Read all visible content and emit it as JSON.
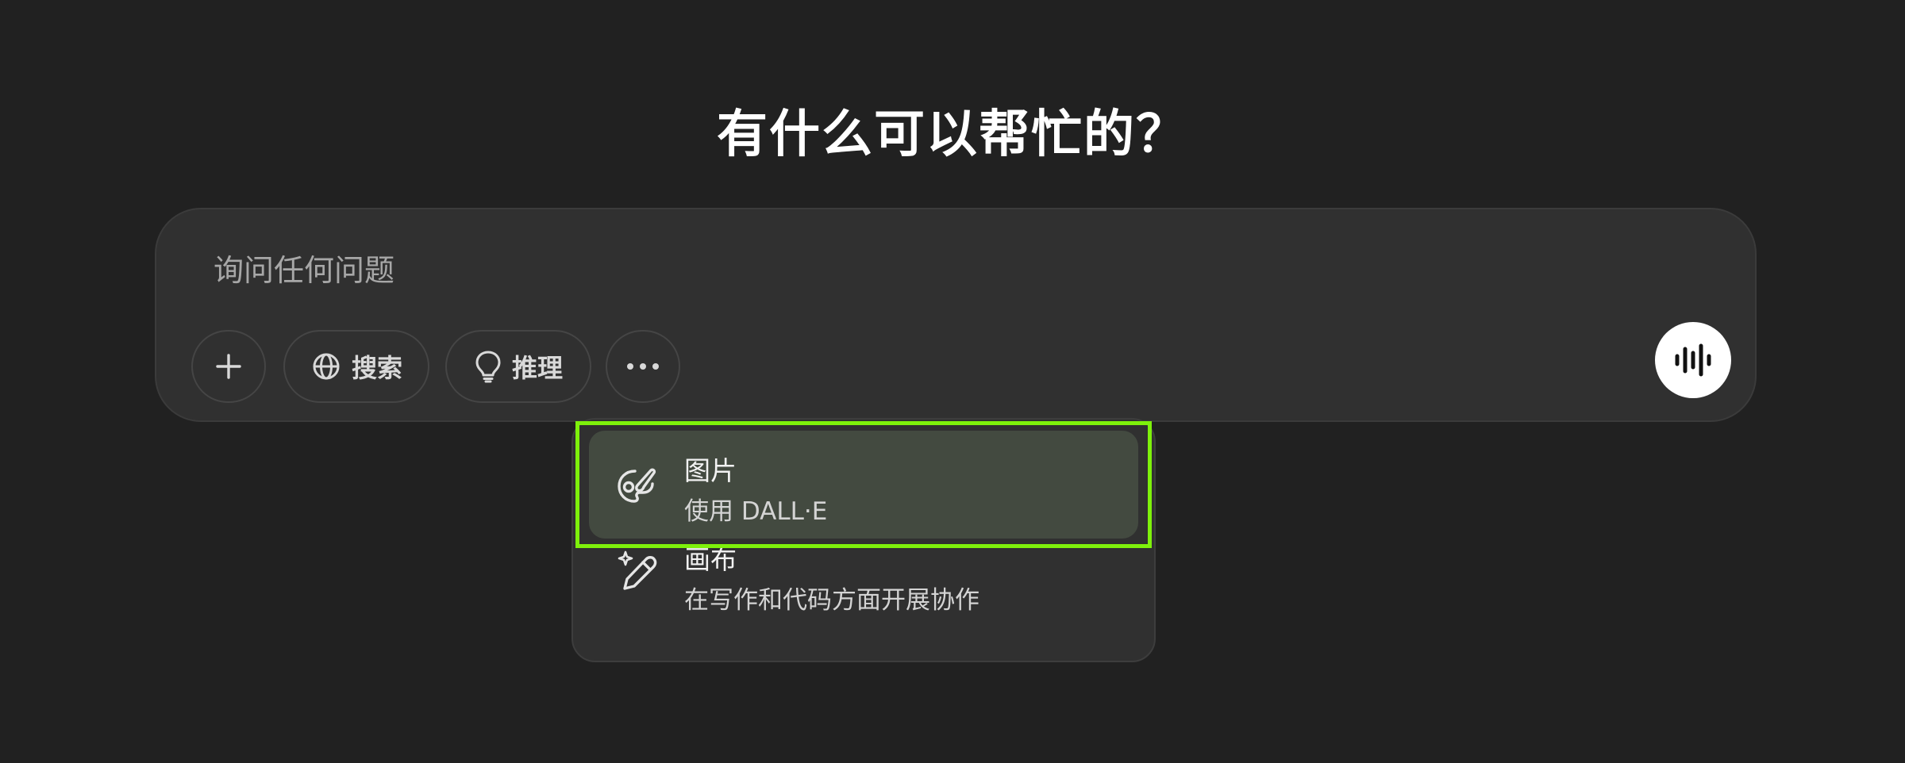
{
  "page": {
    "title": "有什么可以帮忙的？"
  },
  "composer": {
    "placeholder": "询问任何问题",
    "buttons": {
      "add_icon": "plus-icon",
      "search_label": "搜索",
      "search_icon": "globe-icon",
      "reason_label": "推理",
      "reason_icon": "lightbulb-icon",
      "more_icon": "ellipsis-icon"
    },
    "voice_icon": "voice-waveform-icon"
  },
  "menu": {
    "items": [
      {
        "title": "图片",
        "description": "使用 DALL·E",
        "icon": "palette-brush-icon",
        "highlighted": true
      },
      {
        "title": "画布",
        "description": "在写作和代码方面开展协作",
        "icon": "sparkle-pencil-icon",
        "highlighted": false
      }
    ]
  },
  "colors": {
    "background": "#212121",
    "composer": "#303030",
    "highlight": "#434a40",
    "focus_outline": "#7ef10b"
  }
}
